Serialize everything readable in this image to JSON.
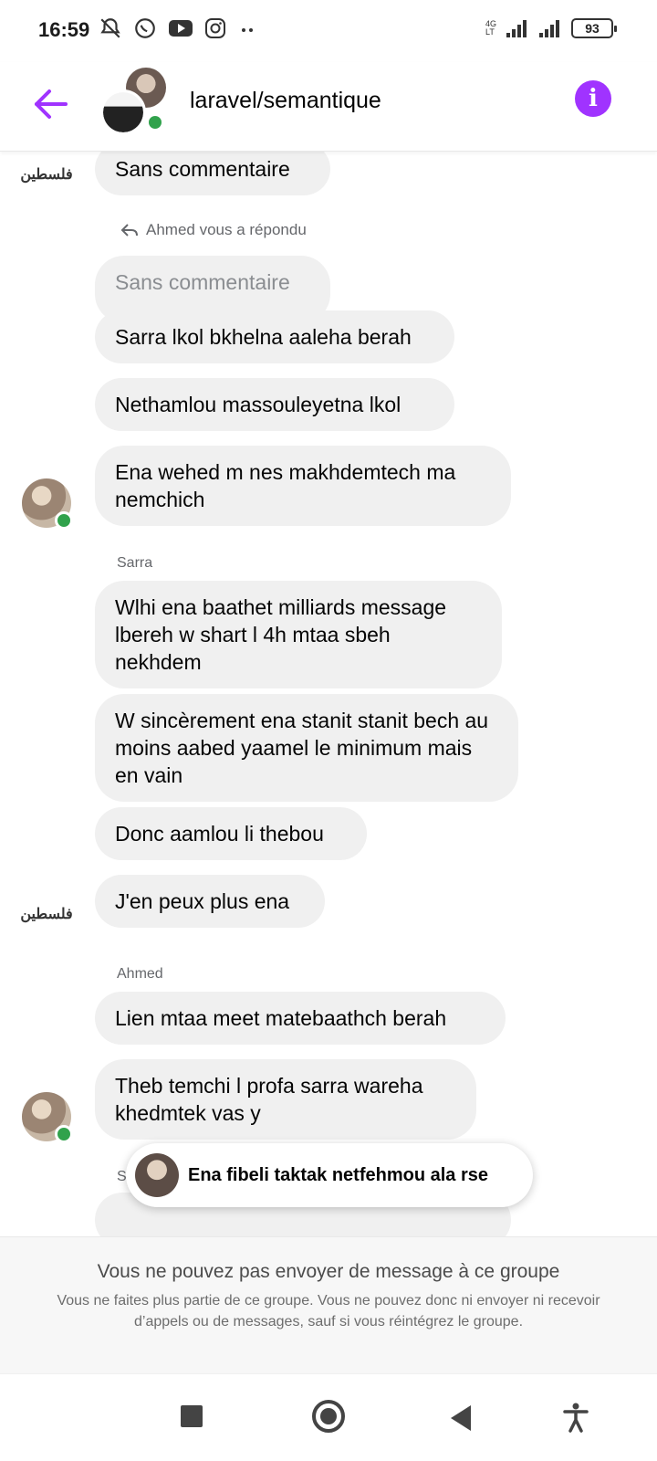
{
  "status_bar": {
    "time": "16:59",
    "battery": "93",
    "network_label_top": "4G",
    "network_label_bottom": "LT",
    "icons": [
      "notifications-off-icon",
      "whatsapp-icon",
      "youtube-icon",
      "instagram-icon",
      "more-dots-icon",
      "signal-icon",
      "signal-icon",
      "battery-icon"
    ]
  },
  "header": {
    "title": "laravel/semantique",
    "back_icon": "arrow-left-icon",
    "info_icon": "info-icon",
    "accent_color": "#a033ff"
  },
  "messages": {
    "m0": "Sans commentaire",
    "reply_note": "Ahmed vous a répondu",
    "quoted": "Sans commentaire",
    "m1": "Sarra lkol bkhelna aaleha berah",
    "m2": "Nethamlou massouleyetna lkol",
    "m3": "Ena wehed m nes makhdemtech ma nemchich",
    "sender1": "Sarra",
    "m4": "Wlhi ena baathet milliards message lbereh w shart l 4h mtaa sbeh nekhdem",
    "m5": "W sincèrement ena stanit stanit bech au moins aabed yaamel le minimum mais en vain",
    "m6": "Donc aamlou li thebou",
    "m7": "J'en peux plus ena",
    "sender2": "Ahmed",
    "m8": "Lien mtaa meet matebaathch berah",
    "m9": "Theb temchi l profa sarra wareha khedmtek vas y",
    "sender3": "Sa"
  },
  "toast": {
    "text": "Ena fibeli taktak netfehmou ala rse"
  },
  "notice": {
    "title": "Vous ne pouvez pas envoyer de message à ce groupe",
    "body": "Vous ne faites plus partie de ce groupe. Vous ne pouvez donc ni envoyer ni recevoir d’appels ou de messages, sauf si vous réintégrez le groupe."
  },
  "nav_bar": {
    "icons": [
      "recent-apps-icon",
      "home-icon",
      "back-icon",
      "accessibility-icon"
    ]
  },
  "colors": {
    "bubble": "#f0f0f0",
    "online": "#31a24c",
    "accent": "#a033ff"
  }
}
